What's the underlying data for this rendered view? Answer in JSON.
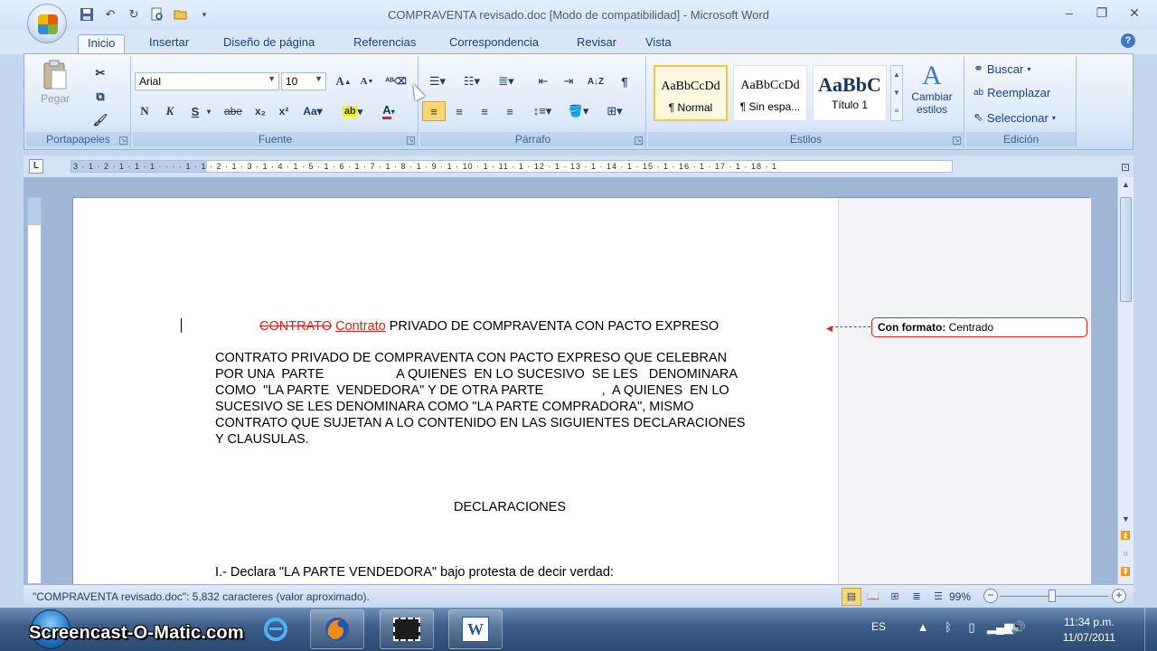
{
  "window": {
    "title": "COMPRAVENTA  revisado.doc [Modo de compatibilidad] - Microsoft Word",
    "controls": [
      "minimize",
      "restore",
      "close"
    ]
  },
  "quick_access": [
    "save-icon",
    "undo-icon",
    "redo-icon",
    "print-preview-icon",
    "open-icon",
    "customize-icon"
  ],
  "tabs": [
    {
      "label": "Inicio",
      "active": true
    },
    {
      "label": "Insertar"
    },
    {
      "label": "Diseño de página"
    },
    {
      "label": "Referencias"
    },
    {
      "label": "Correspondencia"
    },
    {
      "label": "Revisar"
    },
    {
      "label": "Vista"
    }
  ],
  "ribbon": {
    "clipboard": {
      "label": "Portapapeles",
      "paste_label": "Pegar"
    },
    "font": {
      "label": "Fuente",
      "font_name": "Arial",
      "font_size": "10"
    },
    "paragraph": {
      "label": "Párrafo"
    },
    "styles": {
      "label": "Estilos",
      "items": [
        {
          "sample": "AaBbCcDd",
          "name": "¶ Normal",
          "selected": true
        },
        {
          "sample": "AaBbCcDd",
          "name": "¶ Sin espa..."
        },
        {
          "sample": "AaBbC",
          "name": "Título 1"
        }
      ],
      "change_styles": "Cambiar estilos"
    },
    "editing": {
      "label": "Edición",
      "find": "Buscar",
      "replace": "Reemplazar",
      "select": "Seleccionar"
    }
  },
  "ruler": {
    "text": "3 · 1 · 2 · 1 · 1 · 1 · ·  ·  · 1 · 1 · 2 · 1 · 3 · 1 · 4 · 1 · 5 · 1 · 6 · 1 · 7 · 1 · 8 · 1 · 9 · 1 · 10 · 1 · 11 · 1 · 12 · 1 · 13 · 1 · 14 · 1 · 15 · 1 · 16 · 1 · 17 · 1 · 18 · 1"
  },
  "document": {
    "title_deleted": "CONTRATO",
    "title_inserted": "Contrato",
    "title_rest": "PRIVADO DE COMPRAVENTA CON PACTO EXPRESO",
    "para1": [
      "CONTRATO  PRIVADO DE COMPRAVENTA  CON PACTO  EXPRESO QUE CELEBRAN",
      "POR UNA  PARTE                    A QUIENES  EN LO SUCESIVO  SE LES   DENOMINARA",
      "COMO  \"LA PARTE  VENDEDORA\" Y DE OTRA PARTE                ,  A QUIENES  EN LO",
      "SUCESIVO SE LES DENOMINARA COMO \"LA PARTE  COMPRADORA\",  MISMO",
      "CONTRATO  QUE SUJETAN A LO CONTENIDO  EN LAS SIGUIENTES   DECLARACIONES",
      "Y CLAUSULAS."
    ],
    "section_heading": "DECLARACIONES",
    "item1": "I.-  Declara \"LA PARTE VENDEDORA\"  bajo protesta de decir verdad:",
    "comment": {
      "label": "Con formato:",
      "text": "Centrado"
    }
  },
  "status": {
    "text": "\"COMPRAVENTA  revisado.doc\": 5,832 caracteres (valor aproximado).",
    "zoom": "99%",
    "zoom_level_percent": 99
  },
  "taskbar": {
    "watermark": "Screencast-O-Matic.com",
    "apps": [
      "firefox-icon",
      "screen-capture-icon",
      "word-icon"
    ],
    "lang": "ES",
    "time": "11:34 p.m.",
    "date": "11/07/2011"
  },
  "colors": {
    "revision": "#d4281f",
    "ribbon_bg": "#dde9f8",
    "style_selected": "#f6c44d"
  }
}
